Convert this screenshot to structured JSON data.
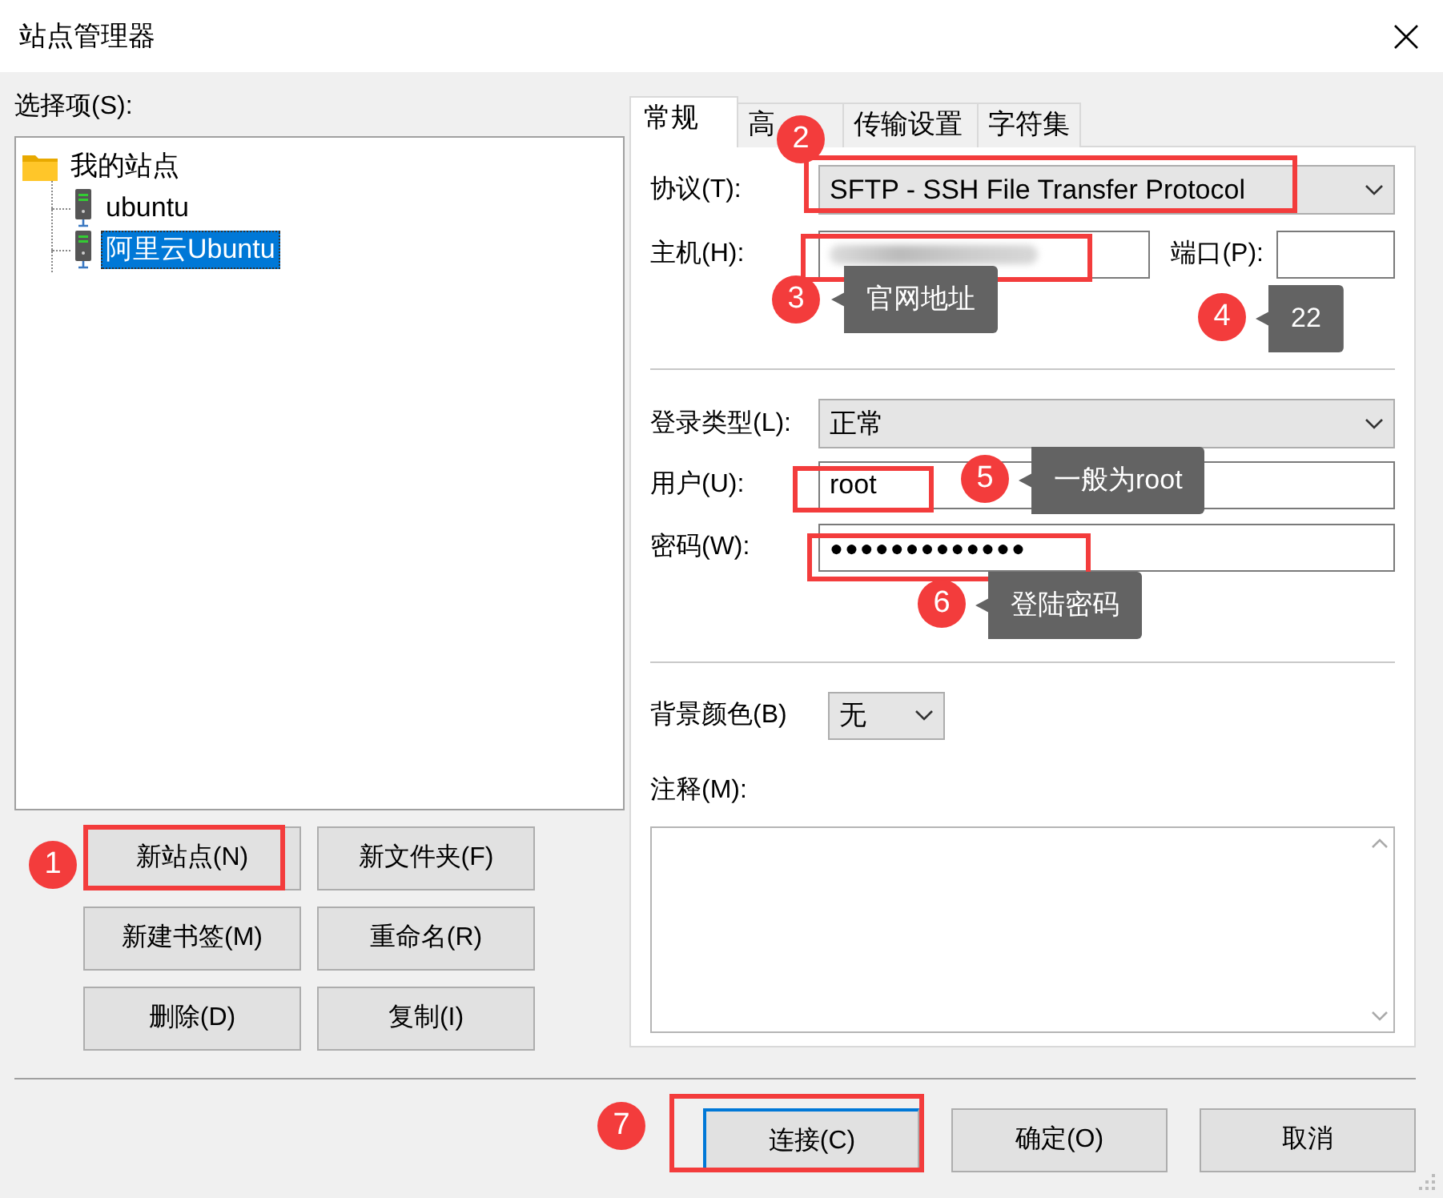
{
  "window": {
    "title": "站点管理器"
  },
  "left": {
    "label": "选择项(S):",
    "tree": [
      {
        "label": "我的站点",
        "kind": "folder",
        "selected": false,
        "children": [
          {
            "label": "ubuntu",
            "kind": "server",
            "selected": false
          },
          {
            "label": "阿里云Ubuntu",
            "kind": "server",
            "selected": true
          }
        ]
      }
    ],
    "buttons": [
      "新站点(N)",
      "新文件夹(F)",
      "新建书签(M)",
      "重命名(R)",
      "删除(D)",
      "复制(I)"
    ]
  },
  "tabs": [
    {
      "label": "常规",
      "selected": true
    },
    {
      "label": "高",
      "selected": false
    },
    {
      "label": "传输设置",
      "selected": false
    },
    {
      "label": "字符集",
      "selected": false
    }
  ],
  "form": {
    "protocol": {
      "label": "协议(T):",
      "value": "SFTP - SSH File Transfer Protocol"
    },
    "host": {
      "label": "主机(H):"
    },
    "port": {
      "label": "端口(P):"
    },
    "logon_type": {
      "label": "登录类型(L):",
      "value": "正常"
    },
    "user": {
      "label": "用户(U):",
      "value": "root"
    },
    "password": {
      "label": "密码(W):",
      "value": "●●●●●●●●●●●●●"
    },
    "background_color": {
      "label": "背景颜色(B)",
      "value": "无"
    },
    "notes": {
      "label": "注释(M):"
    }
  },
  "bottom_buttons": [
    {
      "label": "连接(C)",
      "focused": true
    },
    {
      "label": "确定(O)",
      "focused": false
    },
    {
      "label": "取消",
      "focused": false
    }
  ],
  "annotations": [
    {
      "number": "1"
    },
    {
      "number": "2"
    },
    {
      "number": "3",
      "callout": "官网地址"
    },
    {
      "number": "4",
      "callout": "22"
    },
    {
      "number": "5",
      "callout": "一般为root"
    },
    {
      "number": "6",
      "callout": "登陆密码"
    },
    {
      "number": "7"
    }
  ]
}
